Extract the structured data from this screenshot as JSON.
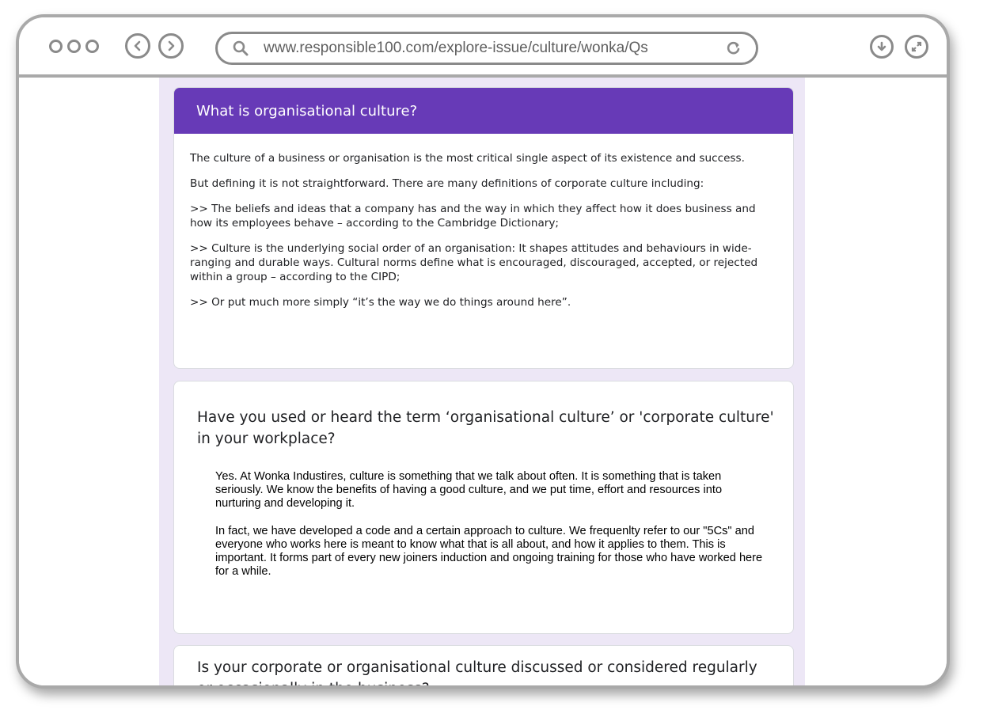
{
  "browser": {
    "url": "www.responsible100.com/explore-issue/culture/wonka/Qs"
  },
  "section": {
    "title": "What is organisational culture?",
    "paragraphs": [
      "The culture of a business or organisation is the most critical single aspect of its existence and success.",
      "But defining it is not straightforward. There are many definitions of corporate culture including:",
      ">> The beliefs and ideas that a company has and the way in which they affect how it does business and how its employees behave – according to the Cambridge Dictionary;",
      ">> Culture is the underlying social order of an organisation: It shapes attitudes and behaviours in wide-ranging and durable ways. Cultural norms define what is encouraged, discouraged, accepted, or rejected within a group – according to the CIPD;",
      ">> Or put much more simply “it’s the way we do things around here”."
    ]
  },
  "question1": {
    "text": "Have you used or heard the term ‘organisational culture’ or 'corporate culture' in your workplace?",
    "answer": [
      "Yes. At Wonka Industires, culture is something that we talk about often. It is something that is taken seriously. We know the benefits of having a good culture, and we put time, effort and resources into nurturing and developing it.",
      "In fact, we have developed a code and a certain approach to culture. We frequenlty refer to our \"5Cs\" and everyone who works here is meant to know what that is all about, and how it applies to them. This is important. It forms part of every new joiners induction and ongoing training for those who have worked here for a while."
    ]
  },
  "question2": {
    "text": "Is your corporate or organisational culture discussed or considered regularly or occasionally in the business?"
  },
  "colors": {
    "header": "#673ab7",
    "form_background": "#ede7f6",
    "chrome": "#8a8a8a"
  }
}
